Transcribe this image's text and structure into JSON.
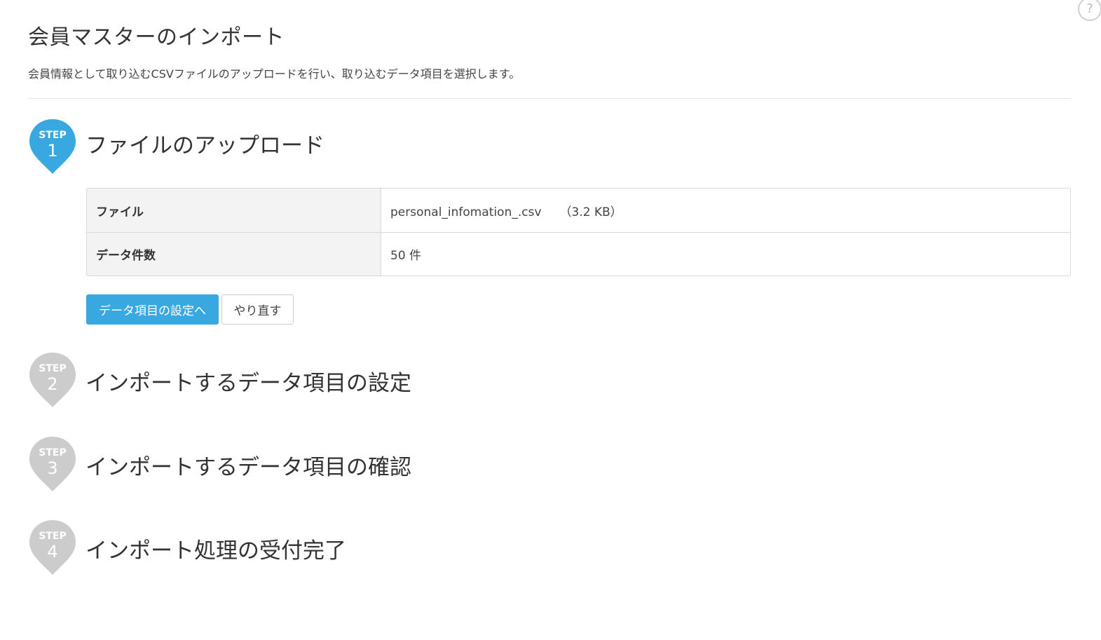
{
  "help": {
    "label": "?"
  },
  "header": {
    "title": "会員マスターのインポート",
    "description": "会員情報として取り込むCSVファイルのアップロードを行い、取り込むデータ項目を選択します。"
  },
  "steps": [
    {
      "badge_label": "STEP",
      "number": "1",
      "title": "ファイルのアップロード",
      "state": "active",
      "color": "#3aa8e0"
    },
    {
      "badge_label": "STEP",
      "number": "2",
      "title": "インポートするデータ項目の設定",
      "state": "inactive",
      "color": "#cccccc"
    },
    {
      "badge_label": "STEP",
      "number": "3",
      "title": "インポートするデータ項目の確認",
      "state": "inactive",
      "color": "#cccccc"
    },
    {
      "badge_label": "STEP",
      "number": "4",
      "title": "インポート処理の受付完了",
      "state": "inactive",
      "color": "#cccccc"
    }
  ],
  "upload_info": {
    "file_label": "ファイル",
    "file_name": "personal_infomation_.csv",
    "file_size": "（3.2 KB）",
    "count_label": "データ件数",
    "count_value": "50 件"
  },
  "actions": {
    "next_label": "データ項目の設定へ",
    "redo_label": "やり直す"
  },
  "colors": {
    "accent": "#3aa8e0",
    "inactive": "#cccccc"
  }
}
